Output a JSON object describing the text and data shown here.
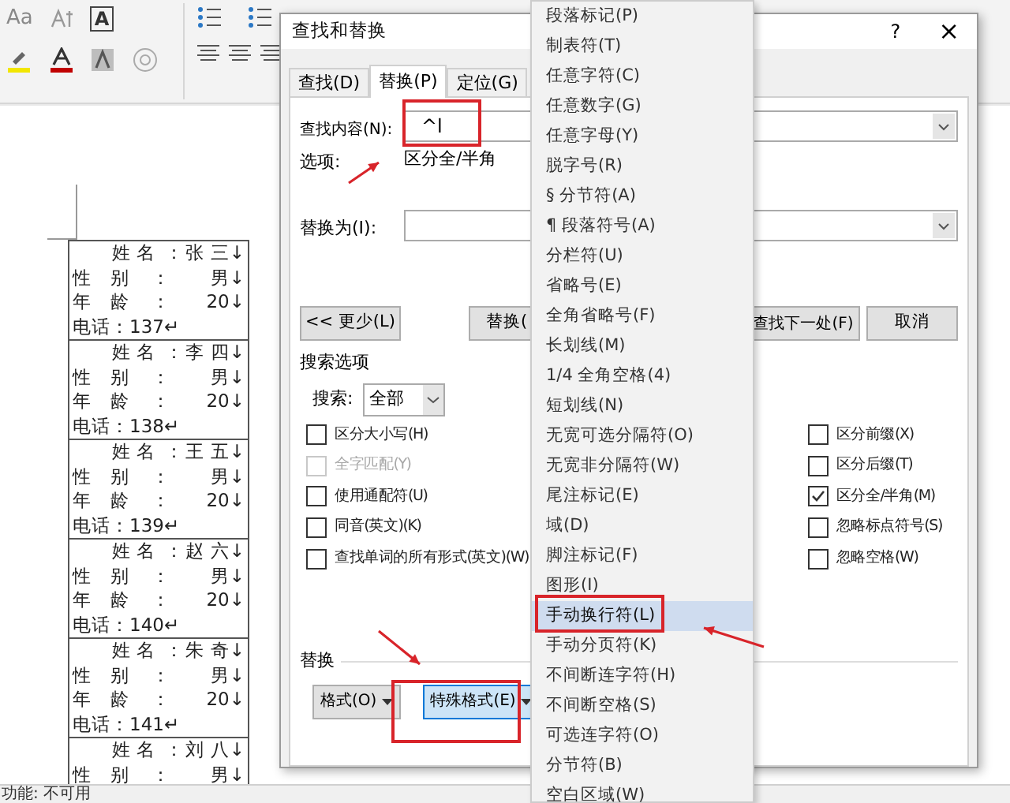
{
  "ribbon": {
    "case_button": "Aa",
    "border_char": "A"
  },
  "document": {
    "records": [
      {
        "rows": [
          {
            "kind": "name",
            "label": "姓 名",
            "colon": "：",
            "value": "张 三↓"
          },
          {
            "kind": "field",
            "label": "性　别",
            "colon": "：",
            "value": "男↓"
          },
          {
            "kind": "field",
            "label": "年　龄",
            "colon": "：",
            "value": "20↓"
          },
          {
            "kind": "phone",
            "label": "电话：137↵"
          }
        ]
      },
      {
        "rows": [
          {
            "kind": "name",
            "label": "姓 名",
            "colon": "：",
            "value": "李 四↓"
          },
          {
            "kind": "field",
            "label": "性　别",
            "colon": "：",
            "value": "男↓"
          },
          {
            "kind": "field",
            "label": "年　龄",
            "colon": "：",
            "value": "20↓"
          },
          {
            "kind": "phone",
            "label": "电话：138↵"
          }
        ]
      },
      {
        "rows": [
          {
            "kind": "name",
            "label": "姓 名",
            "colon": "：",
            "value": "王 五↓"
          },
          {
            "kind": "field",
            "label": "性　别",
            "colon": "：",
            "value": "男↓"
          },
          {
            "kind": "field",
            "label": "年　龄",
            "colon": "：",
            "value": "20↓"
          },
          {
            "kind": "phone",
            "label": "电话：139↵"
          }
        ]
      },
      {
        "rows": [
          {
            "kind": "name",
            "label": "姓 名",
            "colon": "：",
            "value": "赵 六↓"
          },
          {
            "kind": "field",
            "label": "性　别",
            "colon": "：",
            "value": "男↓"
          },
          {
            "kind": "field",
            "label": "年　龄",
            "colon": "：",
            "value": "20↓"
          },
          {
            "kind": "phone",
            "label": "电话：140↵"
          }
        ]
      },
      {
        "rows": [
          {
            "kind": "name",
            "label": "姓 名",
            "colon": "：",
            "value": "朱 奇↓"
          },
          {
            "kind": "field",
            "label": "性　别",
            "colon": "：",
            "value": "男↓"
          },
          {
            "kind": "field",
            "label": "年　龄",
            "colon": "：",
            "value": "20↓"
          },
          {
            "kind": "phone",
            "label": "电话：141↵"
          }
        ]
      },
      {
        "rows": [
          {
            "kind": "name",
            "label": "姓 名",
            "colon": "：",
            "value": "刘 八↓"
          },
          {
            "kind": "field",
            "label": "性　别",
            "colon": "：",
            "value": "男↓"
          }
        ]
      }
    ]
  },
  "status_bar": {
    "text": "功能: 不可用"
  },
  "dialog": {
    "title": "查找和替换",
    "help": "?",
    "close": "×",
    "tabs": [
      {
        "label": "查找(D)",
        "selected": false
      },
      {
        "label": "替换(P)",
        "selected": true
      },
      {
        "label": "定位(G)",
        "selected": false
      }
    ],
    "find": {
      "label": "查找内容(N):",
      "value": "^l"
    },
    "options": {
      "label": "选项:",
      "value": "区分全/半角"
    },
    "replace": {
      "label": "替换为(I):"
    },
    "buttons_left": [
      "<< 更少(L)",
      "替换("
    ],
    "buttons_right": [
      "查找下一处(F)",
      "取消"
    ],
    "search_options": {
      "title": "搜索选项",
      "search_label": "搜索:",
      "search_value": "全部",
      "left_checks": [
        {
          "label": "区分大小写(H)",
          "checked": false,
          "disabled": false
        },
        {
          "label": "全字匹配(Y)",
          "checked": false,
          "disabled": true
        },
        {
          "label": "使用通配符(U)",
          "checked": false,
          "disabled": false
        },
        {
          "label": "同音(英文)(K)",
          "checked": false,
          "disabled": false
        },
        {
          "label": "查找单词的所有形式(英文)(W)",
          "checked": false,
          "disabled": false
        }
      ],
      "right_checks": [
        {
          "label": "区分前缀(X)",
          "checked": false,
          "disabled": false
        },
        {
          "label": "区分后缀(T)",
          "checked": false,
          "disabled": false
        },
        {
          "label": "区分全/半角(M)",
          "checked": true,
          "disabled": false
        },
        {
          "label": "忽略标点符号(S)",
          "checked": false,
          "disabled": false
        },
        {
          "label": "忽略空格(W)",
          "checked": false,
          "disabled": false
        }
      ]
    },
    "replace_section": {
      "title": "替换",
      "buttons": [
        {
          "label": "格式(O)",
          "selected": false
        },
        {
          "label": "特殊格式(E)",
          "selected": true
        }
      ]
    }
  },
  "menu": {
    "items": [
      {
        "label": "段落标记(P)",
        "selected": false
      },
      {
        "label": "制表符(T)",
        "selected": false
      },
      {
        "label": "任意字符(C)",
        "selected": false
      },
      {
        "label": "任意数字(G)",
        "selected": false
      },
      {
        "label": "任意字母(Y)",
        "selected": false
      },
      {
        "label": "脱字号(R)",
        "selected": false
      },
      {
        "label": "§ 分节符(A)",
        "selected": false
      },
      {
        "label": "¶ 段落符号(A)",
        "selected": false
      },
      {
        "label": "分栏符(U)",
        "selected": false
      },
      {
        "label": "省略号(E)",
        "selected": false
      },
      {
        "label": "全角省略号(F)",
        "selected": false
      },
      {
        "label": "长划线(M)",
        "selected": false
      },
      {
        "label": "1/4 全角空格(4)",
        "selected": false
      },
      {
        "label": "短划线(N)",
        "selected": false
      },
      {
        "label": "无宽可选分隔符(O)",
        "selected": false
      },
      {
        "label": "无宽非分隔符(W)",
        "selected": false
      },
      {
        "label": "尾注标记(E)",
        "selected": false
      },
      {
        "label": "域(D)",
        "selected": false
      },
      {
        "label": "脚注标记(F)",
        "selected": false
      },
      {
        "label": "图形(I)",
        "selected": false
      },
      {
        "label": "手动换行符(L)",
        "selected": true
      },
      {
        "label": "手动分页符(K)",
        "selected": false
      },
      {
        "label": "不间断连字符(H)",
        "selected": false
      },
      {
        "label": "不间断空格(S)",
        "selected": false
      },
      {
        "label": "可选连字符(O)",
        "selected": false
      },
      {
        "label": "分节符(B)",
        "selected": false
      },
      {
        "label": "空白区域(W)",
        "selected": false
      }
    ]
  }
}
